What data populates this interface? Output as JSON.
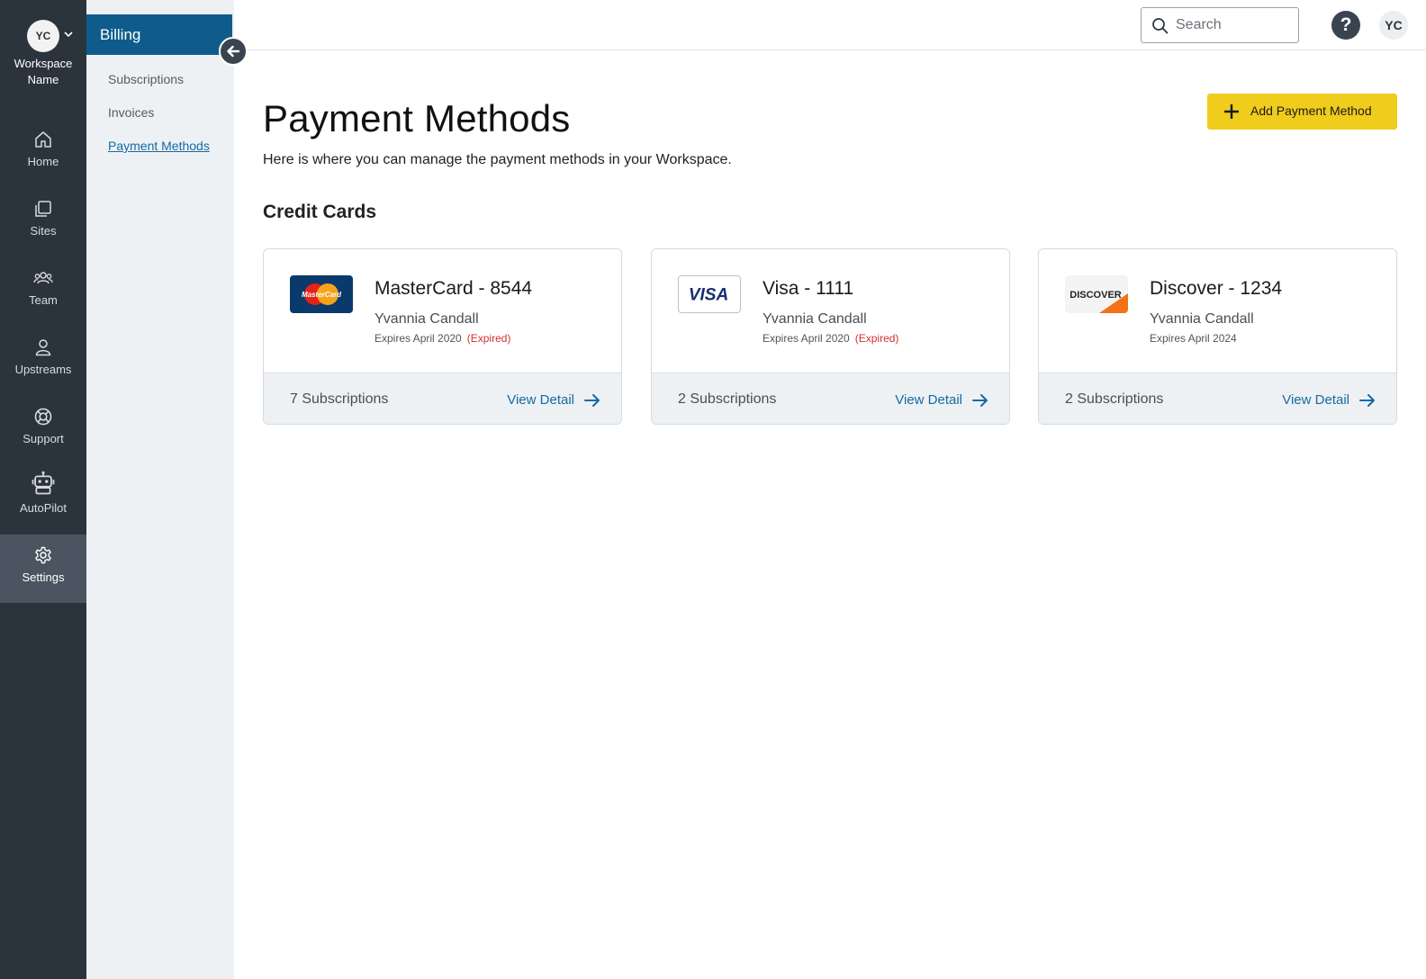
{
  "workspace": {
    "initials": "YC",
    "name_line1": "Workspace",
    "name_line2": "Name"
  },
  "rail": [
    {
      "label": "Home",
      "icon": "home-icon"
    },
    {
      "label": "Sites",
      "icon": "sites-icon"
    },
    {
      "label": "Team",
      "icon": "team-icon"
    },
    {
      "label": "Upstreams",
      "icon": "user-icon"
    },
    {
      "label": "Support",
      "icon": "lifebuoy-icon"
    },
    {
      "label": "AutoPilot",
      "icon": "robot-icon"
    },
    {
      "label": "Settings",
      "icon": "gear-icon",
      "active": true
    }
  ],
  "subnav": {
    "title": "Billing",
    "items": [
      {
        "label": "Subscriptions"
      },
      {
        "label": "Invoices"
      },
      {
        "label": "Payment Methods",
        "active": true
      }
    ]
  },
  "topbar": {
    "search_placeholder": "Search",
    "help_glyph": "?",
    "user_initials": "YC"
  },
  "page": {
    "title": "Payment Methods",
    "description": "Here is where you can manage the payment methods in your Workspace.",
    "add_button": "Add Payment Method",
    "section_title": "Credit Cards"
  },
  "cards": [
    {
      "name": "MasterCard - 8544",
      "holder": "Yvannia Candall",
      "expires": "Expires April 2020",
      "expired_label": "(Expired)",
      "subscriptions": "7 Subscriptions",
      "view_label": "View Detail",
      "logo_text": "MasterCard"
    },
    {
      "name": "Visa - 1111",
      "holder": "Yvannia Candall",
      "expires": "Expires April 2020",
      "expired_label": "(Expired)",
      "subscriptions": "2 Subscriptions",
      "view_label": "View Detail",
      "logo_text": "VISA"
    },
    {
      "name": "Discover - 1234",
      "holder": "Yvannia Candall",
      "expires": "Expires April 2024",
      "expired_label": "",
      "subscriptions": "2 Subscriptions",
      "view_label": "View Detail",
      "logo_text": "DISCOVER"
    }
  ],
  "colors": {
    "rail_bg": "#2b333d",
    "subnav_head": "#0f5c8c",
    "accent_link": "#136aa6",
    "cta_yellow": "#f0cc1c",
    "expired_red": "#d0312d"
  }
}
